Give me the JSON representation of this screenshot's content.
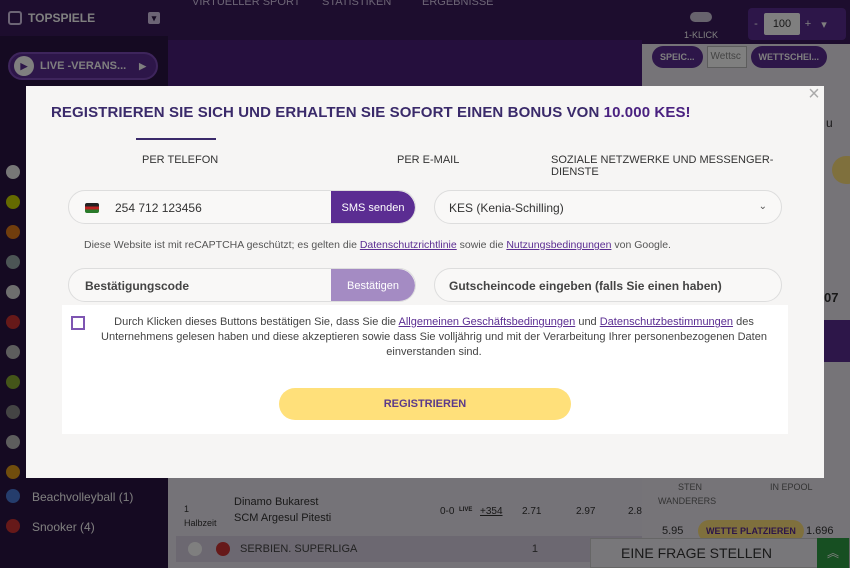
{
  "sidebar": {
    "title": "TOPSPIELE",
    "live_button": "LIVE -VERANS...",
    "items": [
      {
        "label": "Beachvolleyball (1)"
      },
      {
        "label": "Snooker (4)"
      }
    ]
  },
  "topnav": {
    "items": [
      "VIRTUELLER SPORT",
      "STATISTIKEN",
      "ERGEBNISSE"
    ]
  },
  "betslip": {
    "one_click_label": "1-KLICK",
    "stake_minus": "-",
    "stake_value": "100",
    "stake_plus": "+",
    "save_button": "SPEIC...",
    "input_placeholder": "Wettsc",
    "wettschein_button": "WETTSCHEI...",
    "partial_text_1": "u",
    "partial_text_2": "07",
    "place_bet_button": "WETTE PLATZIEREN",
    "partial_team": "WANDERERS",
    "odds_left": "5.95",
    "odds_right": "1.696",
    "partial_ipool": "IN EPOOL",
    "partial_upper": "STEN"
  },
  "match": {
    "time": "1",
    "period": "Halbzeit",
    "team1": "Dinamo Bukarest",
    "team2": "SCM Argesul Pitesti",
    "score": "0-0",
    "live_tag": "LIVE",
    "more_markets": "+354",
    "odds": [
      "2.71",
      "2.97",
      "2.8"
    ]
  },
  "league": {
    "name": "SERBIEN. SUPERLIGA",
    "col": "1"
  },
  "help": {
    "ask_label": "EINE FRAGE STELLEN"
  },
  "modal": {
    "title_prefix": "REGISTRIEREN SIE SICH UND ERHALTEN SIE SOFORT EINEN BONUS VON ",
    "title_bonus": "10.000 KES!",
    "tabs": [
      {
        "label": "PER TELEFON",
        "active": true
      },
      {
        "label": "PER E-MAIL",
        "active": false
      },
      {
        "label": "SOZIALE NETZWERKE UND MESSENGER-DIENSTE",
        "active": false
      }
    ],
    "phone_value": "254 712 123456",
    "sms_button": "SMS senden",
    "currency_value": "KES (Kenia-Schilling)",
    "recaptcha_prefix": "Diese Website ist mit reCAPTCHA geschützt; es gelten die ",
    "privacy_link": "Datenschutzrichtlinie",
    "recaptcha_middle": " sowie die ",
    "terms_link": "Nutzungsbedingungen",
    "recaptcha_suffix": " von Google.",
    "code_placeholder": "Bestätigungscode",
    "confirm_button": "Bestätigen",
    "voucher_placeholder": "Gutscheincode eingeben (falls Sie einen haben)",
    "consent_prefix": "Durch Klicken dieses Buttons bestätigen Sie, dass Sie die ",
    "agb_link": "Allgemeinen Geschäftsbedingungen",
    "consent_middle": " und ",
    "dsb_link": "Datenschutzbestimmungen",
    "consent_suffix": " des Unternehmens gelesen haben und diese akzeptieren sowie dass Sie volljährig und mit der Verarbeitung Ihrer personenbezogenen Daten einverstanden sind.",
    "register_button": "REGISTRIEREN",
    "close_icon": "close-icon"
  },
  "colors": {
    "primary": "#5b2d92",
    "accent_yellow": "#ffe07a",
    "title": "#3a2a6a"
  }
}
